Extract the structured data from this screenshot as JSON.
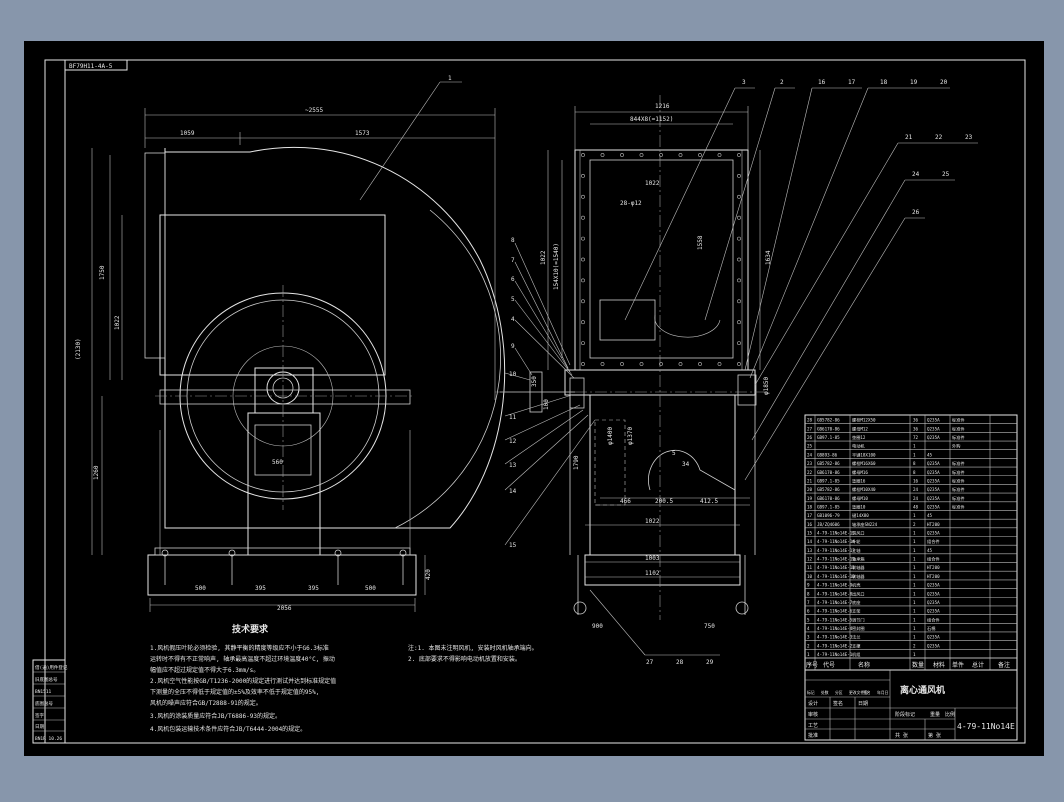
{
  "drawing_number_tag": "BF79H11-4A-5",
  "view1_dims": {
    "overall_width": "~2555",
    "left_width": "1059",
    "right_width": "1573",
    "left_height_total": "(2130)",
    "upper_height": "1750",
    "outlet_height": "1022",
    "lower_height": "1260",
    "opening_width": "560",
    "base_500a": "500",
    "base_395a": "395",
    "base_395b": "395",
    "base_500b": "500",
    "base_total": "2056",
    "base_height": "420"
  },
  "view1_balloon": "1",
  "view2_dims": {
    "top_outer": "1216",
    "top_inner": "844X8(=1152)",
    "inner_width": "1022",
    "flange_holes": "28-φ12",
    "left_height": "1022",
    "left_vertical_pitch": "154X10(=1540)",
    "inner_height": "1558",
    "right_height": "1634",
    "shaft_dia": "φ1850",
    "wheel_dia_a": "φ1400",
    "wheel_dia_b": "φ1370",
    "side_dim": "1790",
    "d_466": "466",
    "d_200": "200.5",
    "d_412": "412.5",
    "d_1022": "1022",
    "d_1003": "1003",
    "d_1102": "1102",
    "d_900": "900",
    "d_750": "750",
    "small_350": "350",
    "small_100": "100",
    "d_34": "34",
    "d_5": "5"
  },
  "balloons_top": [
    "3",
    "2",
    "16",
    "17",
    "18",
    "19",
    "20"
  ],
  "balloons_right": [
    "21",
    "22",
    "23",
    "24",
    "25",
    "26"
  ],
  "balloons_left": [
    "8",
    "7",
    "6",
    "5",
    "4",
    "9",
    "10",
    "11",
    "12",
    "13",
    "14",
    "15"
  ],
  "balloons_bottom": [
    "27",
    "28",
    "29"
  ],
  "tech_title": "技术要求",
  "tech_notes": [
    "1.风机假压叶轮必须检验, 其静平衡的精度等级应不小于G6.3标准",
    "  运转时不得有不正常响声, 轴承最高温度不超过环境温度40°C, 振动",
    "  幅值应不超过规定值不得大于6.3mm/s。",
    "2.风机空气性能按GB/T1236-2000的规定进行测试并达到标准规定值",
    "  下测量的全压不得低于规定值的±5%及效率不低于规定值的95%,",
    "  风机的噪声应符合GB/T2888-91的规定。",
    "3.风机的涂装质量应符合JB/T6886-93的规定。",
    "4.风机包装运输技术条件应符合JB/T6444-2004的规定。"
  ],
  "side_notes": [
    "注:1. 本图未注明风机, 安装时风机轴承端向。",
    "   2. 底部要求不得影响电动机放置和安装。"
  ],
  "left_strip": [
    "借(通)用件登记",
    "旧底图总号",
    "BN1511",
    "底图总号",
    "签字",
    "日期",
    "BN1R 10.26"
  ],
  "bom_rows": [
    [
      "28",
      "GB5782-86",
      "螺栓M12X50",
      "36",
      "Q235A",
      "标准件"
    ],
    [
      "27",
      "GB6170-86",
      "螺母M12",
      "36",
      "Q235A",
      "标准件"
    ],
    [
      "26",
      "GB97.1-85",
      "垫圈12",
      "72",
      "Q235A",
      "标准件"
    ],
    [
      "25",
      "",
      "电动机",
      "1",
      "",
      "外购"
    ],
    [
      "24",
      "GB893-86",
      "平键18X100",
      "1",
      "45",
      ""
    ],
    [
      "23",
      "GB5782-86",
      "螺栓M16X60",
      "8",
      "Q235A",
      "标准件"
    ],
    [
      "22",
      "GB6170-86",
      "螺母M16",
      "8",
      "Q235A",
      "标准件"
    ],
    [
      "21",
      "GB97.1-85",
      "垫圈16",
      "16",
      "Q235A",
      "标准件"
    ],
    [
      "20",
      "GB5782-86",
      "螺栓M10X40",
      "24",
      "Q235A",
      "标准件"
    ],
    [
      "19",
      "GB6170-86",
      "螺母M10",
      "24",
      "Q235A",
      "标准件"
    ],
    [
      "18",
      "GB97.1-85",
      "垫圈10",
      "48",
      "Q235A",
      "标准件"
    ],
    [
      "17",
      "GB1096-79",
      "键14X80",
      "1",
      "45",
      ""
    ],
    [
      "16",
      "JB/ZQ4606",
      "轴承座SN224",
      "2",
      "HT200",
      ""
    ],
    [
      "15",
      "4-79-11No14E-15",
      "进风口",
      "1",
      "Q235A",
      ""
    ],
    [
      "14",
      "4-79-11No14E-14",
      "叶轮",
      "1",
      "组合件",
      ""
    ],
    [
      "13",
      "4-79-11No14E-13",
      "主轴",
      "1",
      "45",
      ""
    ],
    [
      "12",
      "4-79-11No14E-12",
      "轴承箱",
      "1",
      "组合件",
      ""
    ],
    [
      "11",
      "4-79-11No14E-11",
      "联轴器",
      "1",
      "HT200",
      ""
    ],
    [
      "10",
      "4-79-11No14E-10",
      "联轴器",
      "1",
      "HT200",
      ""
    ],
    [
      "9",
      "4-79-11No14E-9",
      "机壳",
      "1",
      "Q235A",
      ""
    ],
    [
      "8",
      "4-79-11No14E-8",
      "出风口",
      "1",
      "Q235A",
      ""
    ],
    [
      "7",
      "4-79-11No14E-7",
      "底座",
      "1",
      "Q235A",
      ""
    ],
    [
      "6",
      "4-79-11No14E-6",
      "支架",
      "1",
      "Q235A",
      ""
    ],
    [
      "5",
      "4-79-11No14E-5",
      "调节门",
      "1",
      "组合件",
      ""
    ],
    [
      "4",
      "4-79-11No14E-4",
      "密封圈",
      "1",
      "石棉",
      ""
    ],
    [
      "3",
      "4-79-11No14E-3",
      "法兰",
      "1",
      "Q235A",
      ""
    ],
    [
      "2",
      "4-79-11No14E-2",
      "支撑",
      "2",
      "Q235A",
      ""
    ],
    [
      "1",
      "4-79-11No14E-1",
      "机组",
      "1",
      "",
      ""
    ]
  ],
  "bom_header": [
    "序号",
    "代号",
    "名称",
    "数量",
    "材料",
    "单件",
    "总计",
    "备注"
  ],
  "title_block": {
    "product_name": "离心通风机",
    "drawing_code": "4-79-11No14E",
    "stage_mark": "阶段标记",
    "weight_label": "重量",
    "scale_label": "比例",
    "total_label": "共 张",
    "sheet_label": "第 张",
    "design": "设计",
    "check": "审核",
    "process": "工艺",
    "approve": "批准",
    "date_label": "日期",
    "sign_label": "签名",
    "revision_row": [
      "标记",
      "处数",
      "分区",
      "更改文件号",
      "签名",
      "年月日"
    ]
  }
}
